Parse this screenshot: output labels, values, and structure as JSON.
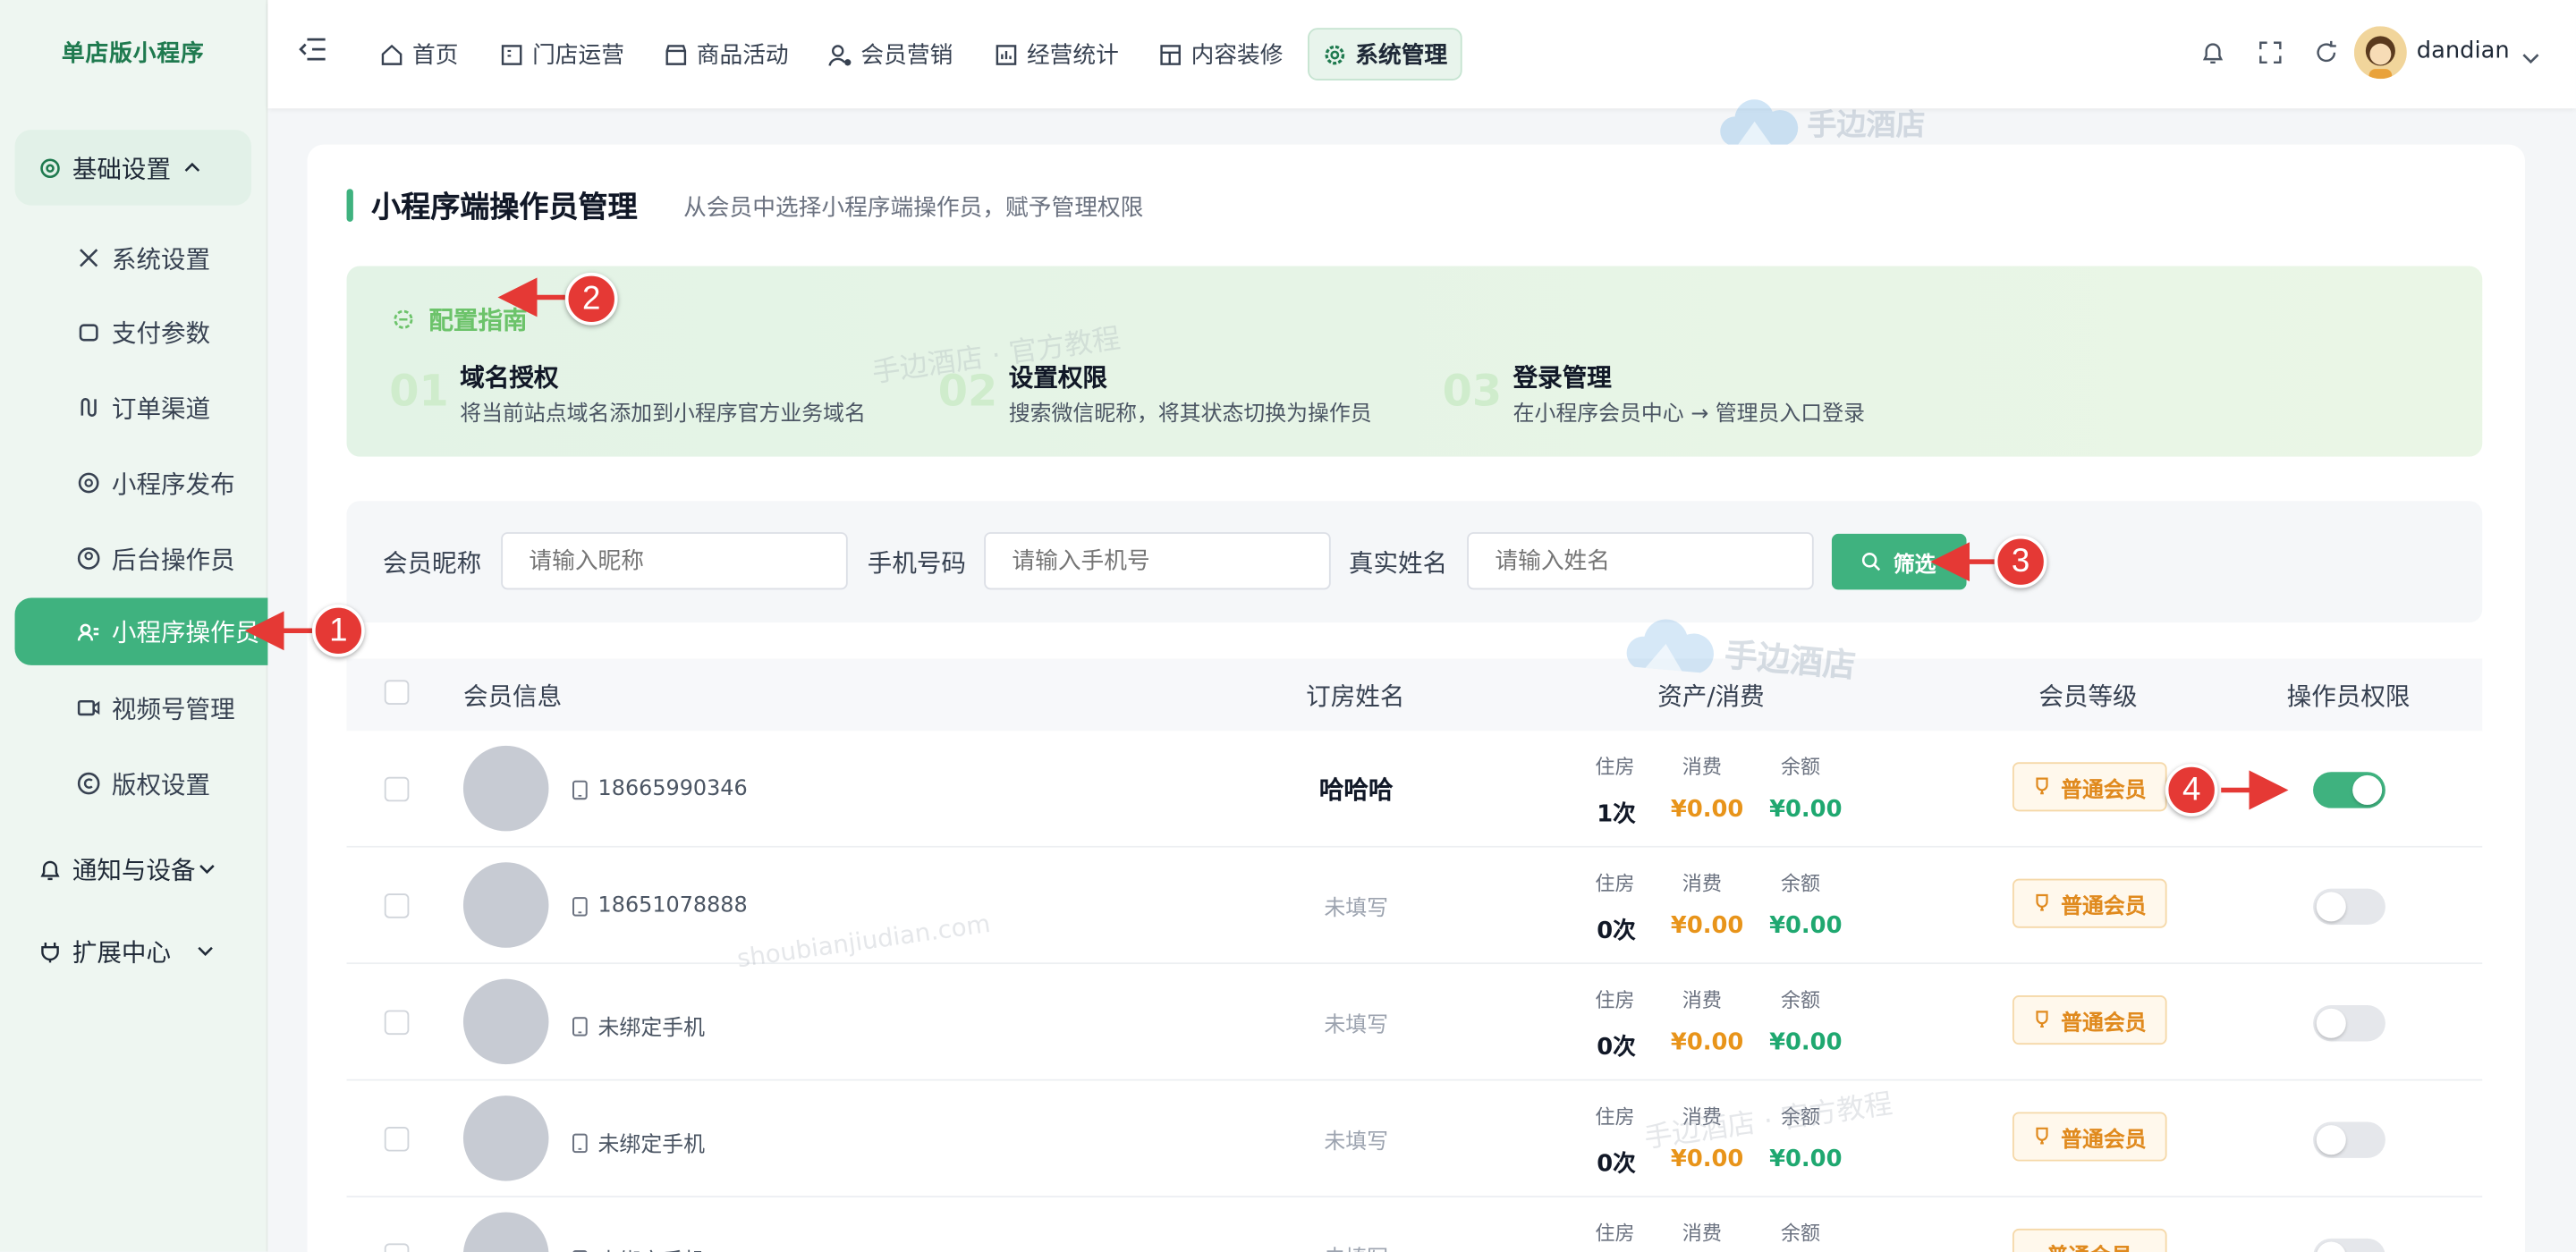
{
  "sidebar": {
    "brand": "单店版小程序",
    "groups": [
      {
        "label": "基础设置"
      },
      {
        "label": "通知与设备"
      },
      {
        "label": "扩展中心"
      }
    ],
    "items": [
      {
        "label": "系统设置",
        "icon": "tools-icon"
      },
      {
        "label": "支付参数",
        "icon": "wallet-icon"
      },
      {
        "label": "订单渠道",
        "icon": "channel-icon"
      },
      {
        "label": "小程序发布",
        "icon": "publish-icon"
      },
      {
        "label": "后台操作员",
        "icon": "user-circle-icon"
      },
      {
        "label": "小程序操作员",
        "icon": "user-list-icon"
      },
      {
        "label": "视频号管理",
        "icon": "video-icon"
      },
      {
        "label": "版权设置",
        "icon": "copyright-icon"
      }
    ]
  },
  "topnav": {
    "items": [
      {
        "label": "首页"
      },
      {
        "label": "门店运营"
      },
      {
        "label": "商品活动"
      },
      {
        "label": "会员营销"
      },
      {
        "label": "经营统计"
      },
      {
        "label": "内容装修"
      },
      {
        "label": "系统管理"
      }
    ],
    "username": "dandian"
  },
  "page": {
    "title": "小程序端操作员管理",
    "subtitle": "从会员中选择小程序端操作员，赋予管理权限"
  },
  "guide": {
    "heading": "配置指南",
    "steps": [
      {
        "no": "01",
        "title": "域名授权",
        "desc": "将当前站点域名添加到小程序官方业务域名"
      },
      {
        "no": "02",
        "title": "设置权限",
        "desc": "搜索微信昵称，将其状态切换为操作员"
      },
      {
        "no": "03",
        "title": "登录管理",
        "desc": "在小程序会员中心 → 管理员入口登录"
      }
    ]
  },
  "filter": {
    "nickname_label": "会员昵称",
    "nickname_placeholder": "请输入昵称",
    "phone_label": "手机号码",
    "phone_placeholder": "请输入手机号",
    "realname_label": "真实姓名",
    "realname_placeholder": "请输入姓名",
    "button": "筛选"
  },
  "table": {
    "headers": [
      "会员信息",
      "订房姓名",
      "资产/消费",
      "会员等级",
      "操作员权限"
    ],
    "sub_labels": [
      "住房",
      "消费",
      "余额"
    ],
    "rows": [
      {
        "phone": "18665990346",
        "booking_name": "哈哈哈",
        "stays": "1次",
        "consumption": "¥0.00",
        "balance": "¥0.00",
        "level": "普通会员",
        "operator": true
      },
      {
        "phone": "18651078888",
        "booking_name": "未填写",
        "stays": "0次",
        "consumption": "¥0.00",
        "balance": "¥0.00",
        "level": "普通会员",
        "operator": false
      },
      {
        "phone": "未绑定手机",
        "booking_name": "未填写",
        "stays": "0次",
        "consumption": "¥0.00",
        "balance": "¥0.00",
        "level": "普通会员",
        "operator": false
      },
      {
        "phone": "未绑定手机",
        "booking_name": "未填写",
        "stays": "0次",
        "consumption": "¥0.00",
        "balance": "¥0.00",
        "level": "普通会员",
        "operator": false
      },
      {
        "phone": "未绑定手机",
        "booking_name": "未填写",
        "stays": "",
        "consumption": "",
        "balance": "",
        "level": "普通会员",
        "operator": false
      }
    ]
  },
  "annotations": [
    "1",
    "2",
    "3",
    "4"
  ],
  "watermarks": {
    "brand": "手边酒店",
    "tutorial": "手边酒店 · 官方教程",
    "url": "shoubianjiudian.com"
  },
  "colors": {
    "accent": "#3fb27f",
    "orange": "#e8941a",
    "green_value": "#1fa870",
    "annotation_red": "#e53935"
  }
}
